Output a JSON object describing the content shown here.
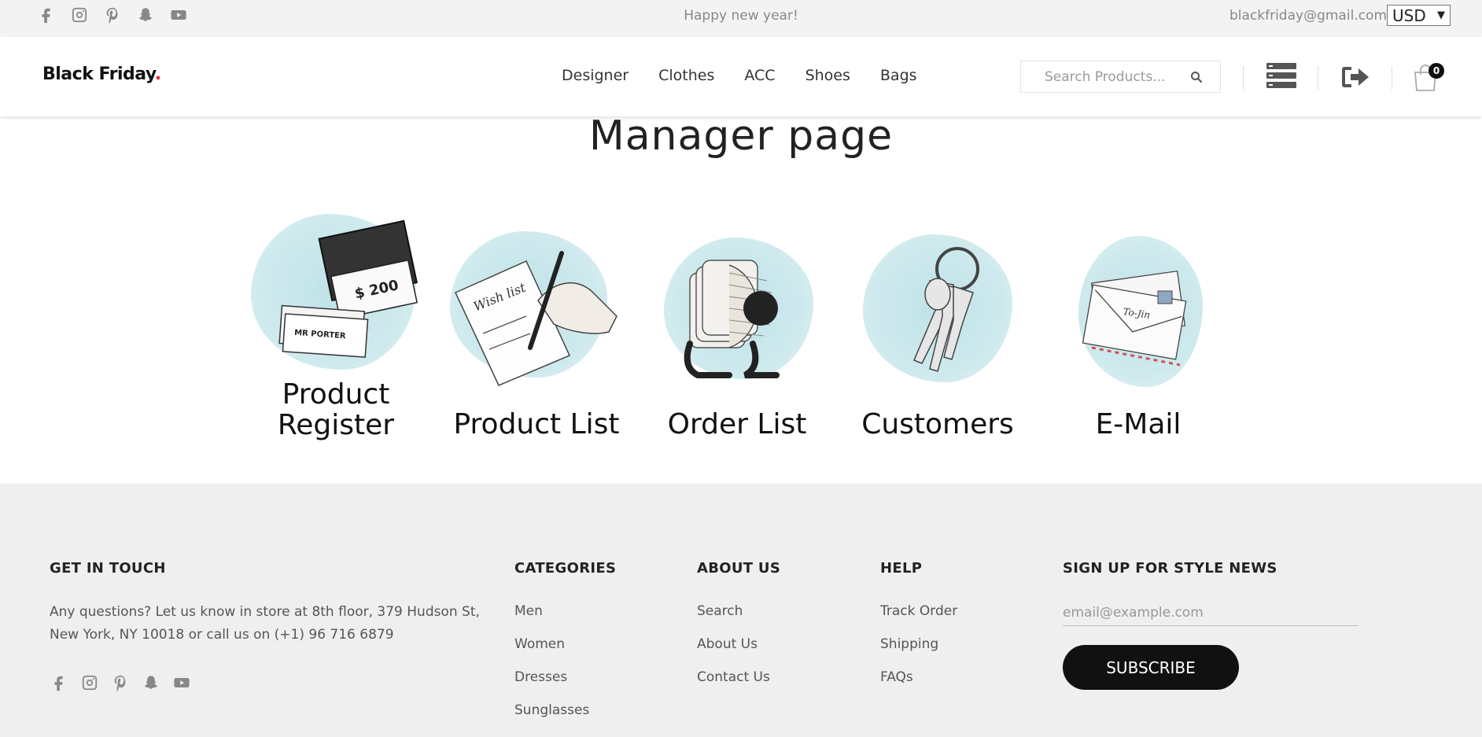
{
  "topbar": {
    "social_icons": [
      "facebook-icon",
      "instagram-icon",
      "pinterest-icon",
      "snapchat-icon",
      "youtube-icon"
    ],
    "notice": "Happy new year!",
    "email": "blackfriday@gmail.com",
    "currency": "USD"
  },
  "header": {
    "logo_text": "Black Friday",
    "logo_dot": ".",
    "nav": [
      "Designer",
      "Clothes",
      "ACC",
      "Shoes",
      "Bags"
    ],
    "search_placeholder": "Search Products...",
    "cart_count": "0",
    "icons": [
      "search-icon",
      "menu-list-icon",
      "logout-icon",
      "shopping-bag-icon"
    ]
  },
  "main": {
    "title": "Manager page",
    "tiles": [
      {
        "label": "Product Register",
        "icon": "gift-card-icon"
      },
      {
        "label": "Product List",
        "icon": "wish-list-icon"
      },
      {
        "label": "Order List",
        "icon": "rolodex-icon"
      },
      {
        "label": "Customers",
        "icon": "keys-icon"
      },
      {
        "label": "E-Mail",
        "icon": "envelopes-icon"
      }
    ],
    "accent": "#cde9ed"
  },
  "footer": {
    "contact": {
      "heading": "GET IN TOUCH",
      "text": "Any questions? Let us know in store at 8th floor, 379 Hudson St, New York, NY 10018 or call us on (+1) 96 716 6879"
    },
    "categories": {
      "heading": "CATEGORIES",
      "links": [
        "Men",
        "Women",
        "Dresses",
        "Sunglasses"
      ]
    },
    "about": {
      "heading": "ABOUT US",
      "links": [
        "Search",
        "About Us",
        "Contact Us"
      ]
    },
    "help": {
      "heading": "HELP",
      "links": [
        "Track Order",
        "Shipping",
        "FAQs"
      ]
    },
    "newsletter": {
      "heading": "SIGN UP FOR STYLE NEWS",
      "placeholder": "email@example.com",
      "button": "SUBSCRIBE"
    }
  }
}
